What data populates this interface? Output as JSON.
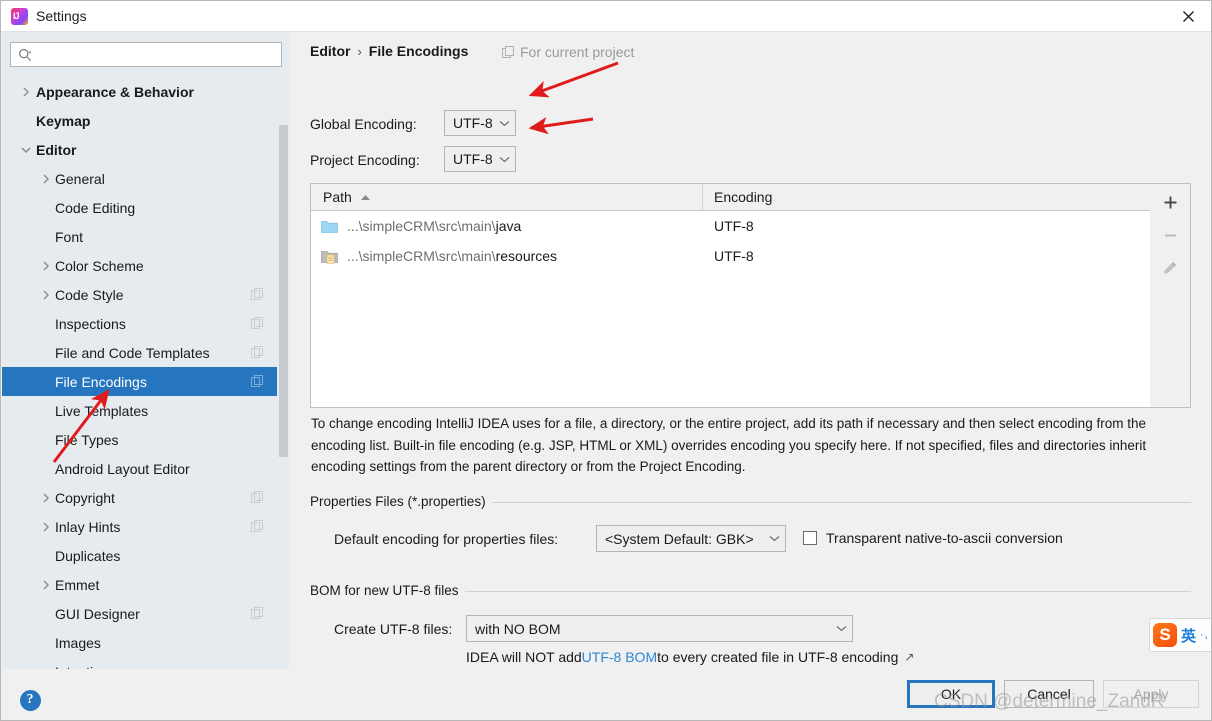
{
  "window": {
    "title": "Settings",
    "logo_icon": "intellij-idea-logo",
    "close_icon": "close-icon"
  },
  "search": {
    "value": "",
    "placeholder": "",
    "icon": "search-icon"
  },
  "sidebar": {
    "items": [
      {
        "label": "Appearance & Behavior",
        "level": 0,
        "chevron": "chevron-right-icon",
        "bold": true,
        "selected": false,
        "copy_badge": false
      },
      {
        "label": "Keymap",
        "level": 0,
        "chevron": "",
        "bold": true,
        "selected": false,
        "copy_badge": false
      },
      {
        "label": "Editor",
        "level": 0,
        "chevron": "chevron-down-icon",
        "bold": true,
        "selected": false,
        "copy_badge": false
      },
      {
        "label": "General",
        "level": 1,
        "chevron": "chevron-right-icon",
        "bold": false,
        "selected": false,
        "copy_badge": false
      },
      {
        "label": "Code Editing",
        "level": 1,
        "chevron": "",
        "bold": false,
        "selected": false,
        "copy_badge": false
      },
      {
        "label": "Font",
        "level": 1,
        "chevron": "",
        "bold": false,
        "selected": false,
        "copy_badge": false
      },
      {
        "label": "Color Scheme",
        "level": 1,
        "chevron": "chevron-right-icon",
        "bold": false,
        "selected": false,
        "copy_badge": false
      },
      {
        "label": "Code Style",
        "level": 1,
        "chevron": "chevron-right-icon",
        "bold": false,
        "selected": false,
        "copy_badge": true
      },
      {
        "label": "Inspections",
        "level": 1,
        "chevron": "",
        "bold": false,
        "selected": false,
        "copy_badge": true
      },
      {
        "label": "File and Code Templates",
        "level": 1,
        "chevron": "",
        "bold": false,
        "selected": false,
        "copy_badge": true
      },
      {
        "label": "File Encodings",
        "level": 1,
        "chevron": "",
        "bold": false,
        "selected": true,
        "copy_badge": true
      },
      {
        "label": "Live Templates",
        "level": 1,
        "chevron": "",
        "bold": false,
        "selected": false,
        "copy_badge": false
      },
      {
        "label": "File Types",
        "level": 1,
        "chevron": "",
        "bold": false,
        "selected": false,
        "copy_badge": false
      },
      {
        "label": "Android Layout Editor",
        "level": 1,
        "chevron": "",
        "bold": false,
        "selected": false,
        "copy_badge": false
      },
      {
        "label": "Copyright",
        "level": 1,
        "chevron": "chevron-right-icon",
        "bold": false,
        "selected": false,
        "copy_badge": true
      },
      {
        "label": "Inlay Hints",
        "level": 1,
        "chevron": "chevron-right-icon",
        "bold": false,
        "selected": false,
        "copy_badge": true
      },
      {
        "label": "Duplicates",
        "level": 1,
        "chevron": "",
        "bold": false,
        "selected": false,
        "copy_badge": false
      },
      {
        "label": "Emmet",
        "level": 1,
        "chevron": "chevron-right-icon",
        "bold": false,
        "selected": false,
        "copy_badge": false
      },
      {
        "label": "GUI Designer",
        "level": 1,
        "chevron": "",
        "bold": false,
        "selected": false,
        "copy_badge": true
      },
      {
        "label": "Images",
        "level": 1,
        "chevron": "",
        "bold": false,
        "selected": false,
        "copy_badge": false
      },
      {
        "label": "Intentions",
        "level": 1,
        "chevron": "",
        "bold": false,
        "selected": false,
        "copy_badge": false
      }
    ]
  },
  "header": {
    "breadcrumb_parent": "Editor",
    "breadcrumb_separator": "›",
    "breadcrumb_current": "File Encodings",
    "scope_hint": "For current project",
    "scope_hint_icon": "copy-badge-icon"
  },
  "encoding": {
    "global_label": "Global Encoding:",
    "global_value": "UTF-8",
    "project_label": "Project Encoding:",
    "project_value": "UTF-8"
  },
  "table": {
    "columns": [
      "Path",
      "Encoding"
    ],
    "sort_column": "Path",
    "sort_direction": "asc",
    "sort_caret": "caret-up-icon",
    "rows": [
      {
        "icon": "folder-icon",
        "path_prefix": "...\\simpleCRM\\src\\main\\",
        "path_leaf": "java",
        "encoding": "UTF-8"
      },
      {
        "icon": "folder-resources-icon",
        "path_prefix": "...\\simpleCRM\\src\\main\\",
        "path_leaf": "resources",
        "encoding": "UTF-8"
      }
    ],
    "toolbar": {
      "add": "add-icon",
      "remove": "remove-icon",
      "edit": "edit-pencil-icon"
    }
  },
  "description": "To change encoding IntelliJ IDEA uses for a file, a directory, or the entire project, add its path if necessary and then select encoding from the encoding list. Built-in file encoding (e.g. JSP, HTML or XML) overrides encoding you specify here. If not specified, files and directories inherit encoding settings from the parent directory or from the Project Encoding.",
  "properties_group": {
    "title": "Properties Files (*.properties)",
    "default_encoding_label": "Default encoding for properties files:",
    "default_encoding_value": "<System Default: GBK>",
    "transparent_label": "Transparent native-to-ascii conversion",
    "transparent_checked": false
  },
  "bom_group": {
    "title": "BOM for new UTF-8 files",
    "create_label": "Create UTF-8 files:",
    "create_value": "with NO BOM",
    "note_prefix": "IDEA will NOT add ",
    "note_link": "UTF-8 BOM",
    "note_suffix": " to every created file in UTF-8 encoding",
    "external_link_icon": "external-link-icon"
  },
  "footer": {
    "help_icon": "help-icon",
    "help_glyph": "?",
    "ok_label": "OK",
    "cancel_label": "Cancel",
    "apply_label": "Apply"
  },
  "overlays": {
    "sogou": {
      "logo_glyph": "S",
      "mode_label": "英",
      "dots": "·,"
    },
    "watermark": "CSDN @determine_ZandR",
    "annotation_arrows": 3,
    "annotation_color": "#e01b1b"
  },
  "colors": {
    "accent": "#2675bf",
    "sidebar_bg": "#e6ebef",
    "panel_bg": "#f0f0f0",
    "link": "#2f86d6",
    "annotation": "#e01b1b"
  }
}
